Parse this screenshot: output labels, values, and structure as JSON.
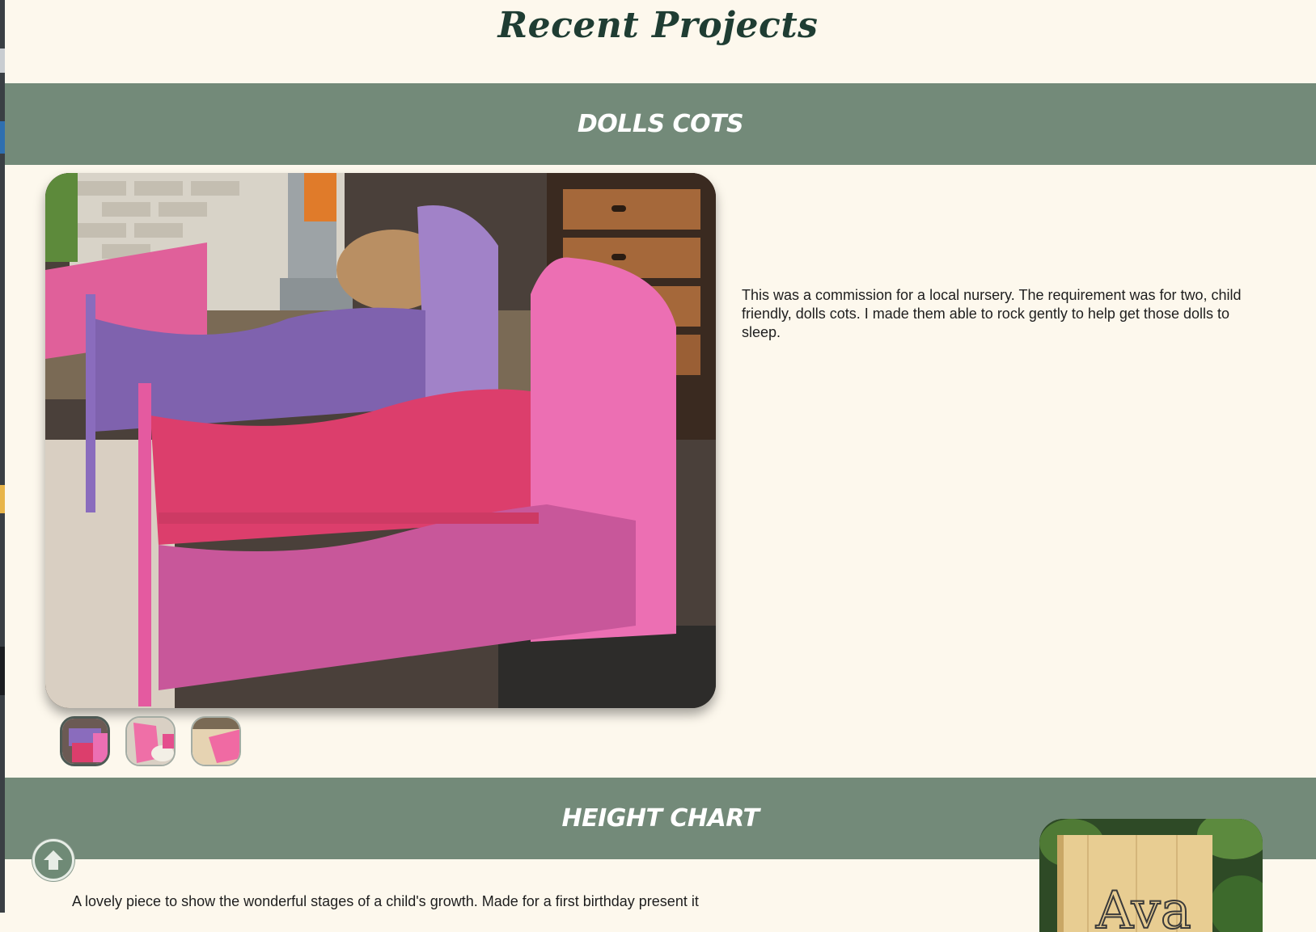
{
  "page": {
    "title": "Recent Projects"
  },
  "projects": [
    {
      "heading": "Dolls Cots",
      "description": "This was a commission for a local nursery. The requirement was for two, child friendly, dolls cots. I made them able to rock gently to help get those dolls to sleep.",
      "thumbnail_count": 3,
      "active_thumbnail": 1
    },
    {
      "heading": "Height Chart",
      "description": "A lovely piece to show the wonderful stages of a child's growth. Made for a first birthday present it",
      "photo_text": "Ava"
    }
  ],
  "icons": {
    "back_to_top": "arrow-up-icon"
  },
  "colors": {
    "background": "#fdf8ed",
    "band": "#738a79",
    "title": "#1f3d33",
    "band_text": "#ffffff"
  }
}
